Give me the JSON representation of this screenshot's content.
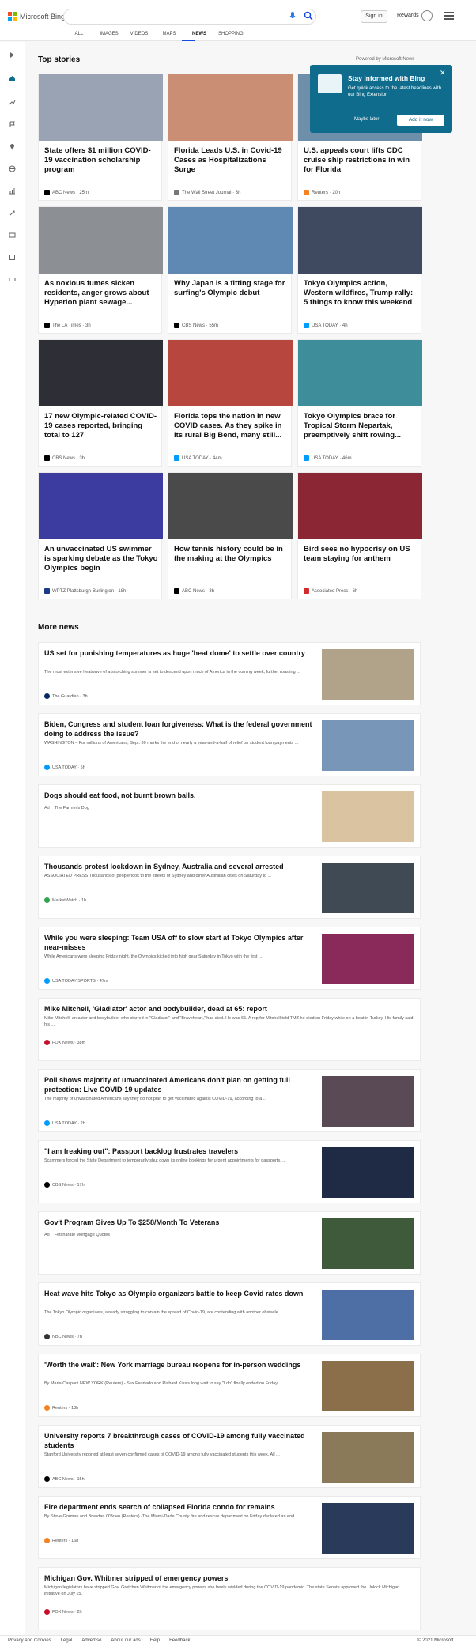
{
  "header": {
    "brand": "Microsoft Bing",
    "signin": "Sign in",
    "rewards": "Rewards",
    "nav": [
      "ALL",
      "IMAGES",
      "VIDEOS",
      "MAPS",
      "NEWS",
      "SHOPPING"
    ],
    "active_nav": "NEWS"
  },
  "top_stories": {
    "title": "Top stories",
    "powered": "Powered by Microsoft News",
    "cards": [
      {
        "title": "State offers $1 million COVID-19 vaccination scholarship program",
        "source": "ABC News · 25m",
        "logo_color": "#000000",
        "thumb_color": "#9aa3b4"
      },
      {
        "title": "Florida Leads U.S. in Covid-19 Cases as Hospitalizations Surge",
        "source": "The Wall Street Journal · 3h",
        "logo_color": "#777777",
        "thumb_color": "#c98e73"
      },
      {
        "title": "U.S. appeals court lifts CDC cruise ship restrictions in win for Florida",
        "source": "Reuters · 20h",
        "logo_color": "#f58220",
        "thumb_color": "#6d8faa"
      },
      {
        "title": "As noxious fumes sicken residents, anger grows about Hyperion plant sewage...",
        "source": "The LA Times · 3h",
        "logo_color": "#000000",
        "thumb_color": "#8c8f93"
      },
      {
        "title": "Why Japan is a fitting stage for surfing's Olympic debut",
        "source": "CBS News · 55m",
        "logo_color": "#000000",
        "thumb_color": "#5f88b3"
      },
      {
        "title": "Tokyo Olympics action, Western wildfires, Trump rally: 5 things to know this weekend",
        "source": "USA TODAY · 4h",
        "logo_color": "#009bff",
        "thumb_color": "#3f4a60"
      },
      {
        "title": "17 new Olympic-related COVID-19 cases reported, bringing total to 127",
        "source": "CBS News · 3h",
        "logo_color": "#000000",
        "thumb_color": "#2e2f36"
      },
      {
        "title": "Florida tops the nation in new COVID cases. As they spike in its rural Big Bend, many still...",
        "source": "USA TODAY · 44m",
        "logo_color": "#009bff",
        "thumb_color": "#b7463f"
      },
      {
        "title": "Tokyo Olympics brace for Tropical Storm Nepartak, preemptively shift rowing...",
        "source": "USA TODAY · 46m",
        "logo_color": "#009bff",
        "thumb_color": "#3d8e9a"
      },
      {
        "title": "An unvaccinated US swimmer is sparking debate as the Tokyo Olympics begin",
        "source": "WPTZ Plattsburgh-Burlington · 18h",
        "logo_color": "#1a3a8a",
        "thumb_color": "#3b3ba0"
      },
      {
        "title": "How tennis history could be in the making at the Olympics",
        "source": "ABC News · 3h",
        "logo_color": "#000000",
        "thumb_color": "#4a4a4a"
      },
      {
        "title": "Bird sees no hypocrisy on US team staying for anthem",
        "source": "Associated Press · 6h",
        "logo_color": "#d12b2b",
        "thumb_color": "#8b2635"
      }
    ]
  },
  "popup": {
    "title": "Stay informed with Bing",
    "text": "Get quick access to the latest headlines with our Bing Extension",
    "maybe_later": "Maybe later",
    "add_now": "Add it now"
  },
  "more_news": {
    "title": "More news",
    "items": [
      {
        "title": "US set for punishing temperatures as huge 'heat dome' to settle over country",
        "body": "The most extensive heatwave of a scorching summer is set to descend upon much of America in the coming week, further roasting ...",
        "source": "The Guardian · 3h",
        "ad": "",
        "logo_color": "#052962",
        "thumb_color": "#b1a28a"
      },
      {
        "title": "Biden, Congress and student loan forgiveness: What is the federal government doing to address the issue?",
        "body": "WASHINGTON – For millions of Americans, Sept. 30 marks the end of nearly a year-and-a-half of relief on student loan payments ...",
        "source": "USA TODAY · 5h",
        "ad": "",
        "logo_color": "#009bff",
        "thumb_color": "#7896b8"
      },
      {
        "title": "Dogs should eat food, not burnt brown balls.",
        "body": "",
        "source": "The Farmer's Dog",
        "ad": "Ad",
        "logo_color": "",
        "thumb_color": "#d9c3a0"
      },
      {
        "title": "Thousands protest lockdown in Sydney, Australia and several arrested",
        "body": "ASSOCIATED PRESS Thousands of people took to the streets of Sydney and other Australian cities on Saturday to ...",
        "source": "MarketWatch · 1h",
        "ad": "",
        "logo_color": "#2ea44f",
        "thumb_color": "#3f4a55"
      },
      {
        "title": "While you were sleeping: Team USA off to slow start at Tokyo Olympics after near-misses",
        "body": "While Americans were sleeping Friday night, the Olympics kicked into high gear Saturday in Tokyo with the first ...",
        "source": "USA TODAY SPORTS · 47m",
        "ad": "",
        "logo_color": "#009bff",
        "thumb_color": "#8a2a5a"
      },
      {
        "title": "Mike Mitchell, 'Gladiator' actor and bodybuilder, dead at 65: report",
        "body": "Mike Mitchell, an actor and bodybuilder who starred in \"Gladiator\" and \"Braveheart,\" has died. He was 65. A rep for Mitchell told TMZ he died on Friday while on a boat in Turkey. His family said his ...",
        "source": "FOX News · 38m",
        "ad": "",
        "logo_color": "#c8102e",
        "thumb_color": ""
      },
      {
        "title": "Poll shows majority of unvaccinated Americans don't plan on getting full protection: Live COVID-19 updates",
        "body": "The majority of unvaccinated Americans say they do not plan to get vaccinated against COVID-19, according to a ...",
        "source": "USA TODAY · 2h",
        "ad": "",
        "logo_color": "#009bff",
        "thumb_color": "#5a4a55"
      },
      {
        "title": "\"I am freaking out\": Passport backlog frustrates travelers",
        "body": "Scammers forced the State Department to temporarily shut down its online bookings for urgent appointments for passports, ...",
        "source": "CBS News · 17h",
        "ad": "",
        "logo_color": "#000000",
        "thumb_color": "#1f2a44"
      },
      {
        "title": "Gov't Program Gives Up To $258/Month To Veterans",
        "body": "",
        "source": "Fetcharate Mortgage Quotes",
        "ad": "Ad",
        "logo_color": "",
        "thumb_color": "#3e5a3a"
      },
      {
        "title": "Heat wave hits Tokyo as Olympic organizers battle to keep Covid rates down",
        "body": "The Tokyo Olympic organizers, already struggling to contain the spread of Covid-19, are contending with another obstacle ...",
        "source": "NBC News · 7h",
        "ad": "",
        "logo_color": "#333333",
        "thumb_color": "#4d6fa6"
      },
      {
        "title": "'Worth the wait': New York marriage bureau reopens for in-person weddings",
        "body": "By Maria Caspani NEW YORK (Reuters) - Sex Feurtado and Richard Kiss's long wait to say \"I do\" finally ended on Friday, ...",
        "source": "Reuters · 18h",
        "ad": "",
        "logo_color": "#f58220",
        "thumb_color": "#8a6f4a"
      },
      {
        "title": "University reports 7 breakthrough cases of COVID-19 among fully vaccinated students",
        "body": "Stanford University reported at least seven confirmed cases of COVID-19 among fully vaccinated students this week. All ...",
        "source": "ABC News · 15h",
        "ad": "",
        "logo_color": "#000000",
        "thumb_color": "#8a7a5a"
      },
      {
        "title": "Fire department ends search of collapsed Florida condo for remains",
        "body": "By Steve Gorman and Brendan O'Brien (Reuters) -The Miami-Dade County fire and rescue department on Friday declared an end ...",
        "source": "Reuters · 16h",
        "ad": "",
        "logo_color": "#f58220",
        "thumb_color": "#2a3a5a"
      },
      {
        "title": "Michigan Gov. Whitmer stripped of emergency powers",
        "body": "Michigan legislators have stripped Gov. Gretchen Whitmer of the emergency powers she freely wielded during the COVID-19 pandemic. The state Senate approved the Unlock Michigan initiative on July 15.",
        "source": "FOX News · 2h",
        "ad": "",
        "logo_color": "#c8102e",
        "thumb_color": ""
      }
    ]
  },
  "footer": {
    "links": [
      "Privacy and Cookies",
      "Legal",
      "Advertise",
      "About our ads",
      "Help",
      "Feedback"
    ],
    "copyright": "© 2021 Microsoft"
  }
}
